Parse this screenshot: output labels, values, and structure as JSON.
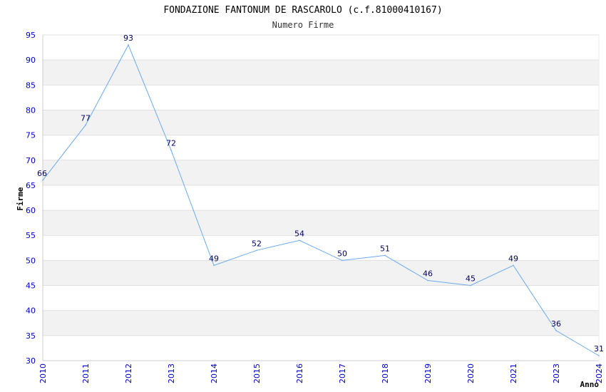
{
  "chart_data": {
    "type": "line",
    "title": "FONDAZIONE FANTONUM DE RASCAROLO (c.f.81000410167)",
    "subtitle": "Numero Firme",
    "xlabel": "Anno",
    "ylabel": "Firme",
    "categories": [
      "2010",
      "2011",
      "2012",
      "2013",
      "2014",
      "2015",
      "2016",
      "2017",
      "2018",
      "2019",
      "2020",
      "2021",
      "2023",
      "2024"
    ],
    "series": [
      {
        "values": [
          66,
          77,
          93,
          72,
          49,
          52,
          54,
          50,
          51,
          46,
          45,
          49,
          36,
          31
        ]
      }
    ],
    "ylim": [
      30,
      95
    ],
    "yticks": [
      30,
      35,
      40,
      45,
      50,
      55,
      60,
      65,
      70,
      75,
      80,
      85,
      90,
      95
    ],
    "grid": true,
    "line_color": "#6aaaf0",
    "band_color": "#f2f2f2",
    "tick_color": "#0000cc",
    "label_color": "#000066"
  }
}
